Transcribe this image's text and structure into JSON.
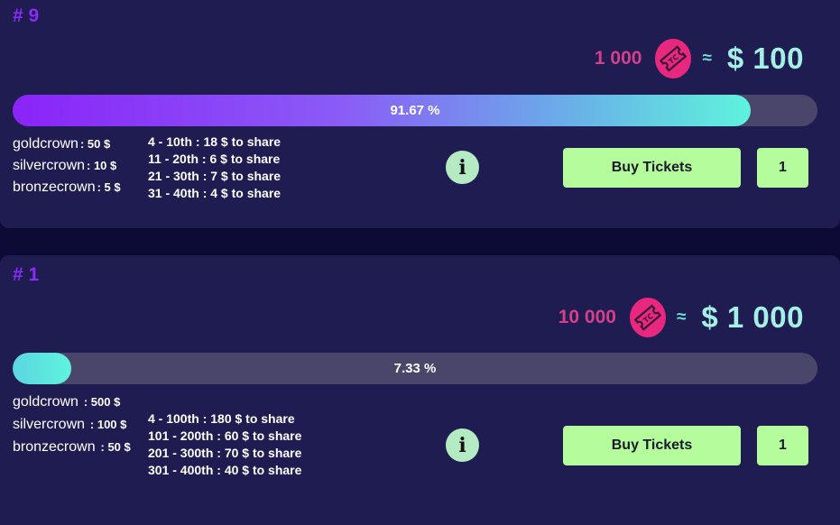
{
  "lotteries": [
    {
      "rank": "# 9",
      "ticket_count": "1 000",
      "approx": "≈",
      "dollar_value": "$ 100",
      "progress_label": "91.67 %",
      "progress_fraction": 0.9167,
      "crowns": [
        {
          "alt": "goldcrown",
          "value": ": 50 $"
        },
        {
          "alt": "silvercrown",
          "value": ": 10 $"
        },
        {
          "alt": "bronzecrown",
          "value": ": 5 $"
        }
      ],
      "shares": [
        "4 - 10th : 18 $ to share",
        "11 - 20th : 6 $ to share",
        "21 - 30th : 7 $ to share",
        "31 - 40th : 4 $ to share"
      ],
      "info_label": "i",
      "buy_label": "Buy Tickets",
      "quantity": "1"
    },
    {
      "rank": "# 1",
      "ticket_count": "10 000",
      "approx": "≈",
      "dollar_value": "$ 1 000",
      "progress_label": "7.33 %",
      "progress_fraction": 0.0733,
      "crowns": [
        {
          "alt": "goldcrown",
          "value": ": 500 $"
        },
        {
          "alt": "silvercrown",
          "value": ": 100 $"
        },
        {
          "alt": "bronzecrown",
          "value": ": 50 $"
        }
      ],
      "shares": [
        "4 - 100th : 180 $ to share",
        "101 - 200th : 60 $ to share",
        "201 - 300th : 70 $ to share",
        "301 - 400th : 40 $ to share"
      ],
      "info_label": "i",
      "buy_label": "Buy Tickets",
      "quantity": "1"
    }
  ],
  "colors": {
    "page_bg": "#0c0a35",
    "card_bg": "#1f1c52",
    "rank": "#8a2bf7",
    "ticket_count": "#d6408a",
    "ticket_icon": "#e8287e",
    "dollar_value": "#a5f0e4",
    "button_bg": "#b5fc9c",
    "info_bg": "#b4ebc3",
    "progress_track": "#4a456a"
  },
  "icons": {
    "ticket": "ticket-coin-icon",
    "info": "info-icon"
  }
}
